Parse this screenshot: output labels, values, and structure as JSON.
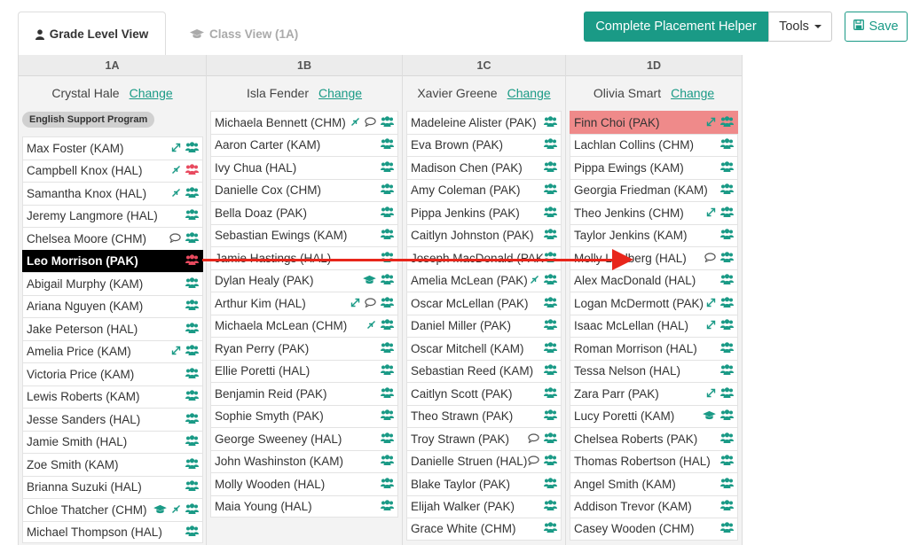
{
  "tabs": [
    {
      "label": "Grade Level View",
      "active": true,
      "icon": "user-icon"
    },
    {
      "label": "Class View (1A)",
      "active": false,
      "icon": "graduation-cap-icon"
    }
  ],
  "toolbar": {
    "helper_label": "Complete Placement Helper",
    "tools_label": "Tools",
    "save_label": "Save"
  },
  "colors": {
    "accent": "#1a9a86",
    "selected": "#000000",
    "flag_red": "#ef8a8a",
    "highlight": "#cccbf3",
    "arrow": "#e8261b"
  },
  "change_label": "Change",
  "classes": [
    {
      "name": "1A",
      "teacher": "Crystal Hale",
      "program": "English Support Program",
      "students": [
        {
          "name": "Max Foster (KAM)",
          "icons": [
            "arrows-icon",
            "group-icon"
          ]
        },
        {
          "name": "Campbell Knox (HAL)",
          "icons": [
            "arrows-in-icon",
            "group-red-icon"
          ]
        },
        {
          "name": "Samantha Knox (HAL)",
          "icons": [
            "arrows-in-icon",
            "group-icon"
          ]
        },
        {
          "name": "Jeremy Langmore (HAL)",
          "icons": [
            "group-icon"
          ]
        },
        {
          "name": "Chelsea Moore (CHM)",
          "icons": [
            "comment-icon",
            "group-icon"
          ]
        },
        {
          "name": "Leo Morrison (PAK)",
          "icons": [
            "group-red-icon"
          ],
          "state": "selected"
        },
        {
          "name": "Abigail Murphy (KAM)",
          "icons": [
            "group-icon"
          ]
        },
        {
          "name": "Ariana Nguyen (KAM)",
          "icons": [
            "group-icon"
          ]
        },
        {
          "name": "Jake Peterson (HAL)",
          "icons": [
            "group-icon"
          ]
        },
        {
          "name": "Amelia Price (KAM)",
          "icons": [
            "arrows-icon",
            "group-icon"
          ]
        },
        {
          "name": "Victoria Price (KAM)",
          "icons": [
            "group-icon"
          ]
        },
        {
          "name": "Lewis Roberts (KAM)",
          "icons": [
            "group-icon"
          ]
        },
        {
          "name": "Jesse Sanders (HAL)",
          "icons": [
            "group-icon"
          ]
        },
        {
          "name": "Jamie Smith (HAL)",
          "icons": [
            "group-icon"
          ]
        },
        {
          "name": "Zoe Smith (KAM)",
          "icons": [
            "group-icon"
          ]
        },
        {
          "name": "Brianna Suzuki (HAL)",
          "icons": [
            "group-icon"
          ]
        },
        {
          "name": "Chloe Thatcher (CHM)",
          "icons": [
            "graduation-cap-icon",
            "arrows-in-icon",
            "group-icon"
          ]
        },
        {
          "name": "Michael Thompson (HAL)",
          "icons": [
            "group-icon"
          ]
        }
      ]
    },
    {
      "name": "1B",
      "teacher": "Isla Fender",
      "students": [
        {
          "name": "Michaela Bennett (CHM)",
          "icons": [
            "arrows-in-icon",
            "comment-icon",
            "group-icon"
          ]
        },
        {
          "name": "Aaron Carter (KAM)",
          "icons": [
            "group-icon"
          ]
        },
        {
          "name": "Ivy Chua (HAL)",
          "icons": [
            "group-icon"
          ]
        },
        {
          "name": "Danielle Cox (CHM)",
          "icons": [
            "group-icon"
          ]
        },
        {
          "name": "Bella Doaz (PAK)",
          "icons": [
            "group-icon"
          ]
        },
        {
          "name": "Sebastian Ewings (KAM)",
          "icons": [
            "group-icon"
          ]
        },
        {
          "name": "Jamie Hastings (HAL)",
          "icons": [
            "group-icon"
          ]
        },
        {
          "name": "Dylan Healy (PAK)",
          "icons": [
            "graduation-cap-icon",
            "group-icon"
          ]
        },
        {
          "name": "Arthur Kim (HAL)",
          "icons": [
            "arrows-icon",
            "comment-icon",
            "group-icon"
          ]
        },
        {
          "name": "Michaela McLean (CHM)",
          "icons": [
            "arrows-in-icon",
            "group-icon"
          ]
        },
        {
          "name": "Ryan Perry (PAK)",
          "icons": [
            "group-icon"
          ]
        },
        {
          "name": "Ellie Poretti (HAL)",
          "icons": [
            "group-icon"
          ]
        },
        {
          "name": "Benjamin Reid (PAK)",
          "icons": [
            "group-icon"
          ]
        },
        {
          "name": "Sophie Smyth (PAK)",
          "icons": [
            "group-icon"
          ]
        },
        {
          "name": "George Sweeney (HAL)",
          "icons": [
            "group-icon"
          ]
        },
        {
          "name": "John Washinston (KAM)",
          "icons": [
            "group-icon"
          ]
        },
        {
          "name": "Molly Wooden (HAL)",
          "icons": [
            "group-icon"
          ]
        },
        {
          "name": "Maia Young (HAL)",
          "icons": [
            "group-icon"
          ]
        }
      ]
    },
    {
      "name": "1C",
      "teacher": "Xavier Greene",
      "students": [
        {
          "name": "Madeleine Alister (PAK)",
          "icons": [
            "group-icon"
          ]
        },
        {
          "name": "Eva Brown (PAK)",
          "icons": [
            "group-icon"
          ]
        },
        {
          "name": "Madison Chen (PAK)",
          "icons": [
            "group-icon"
          ]
        },
        {
          "name": "Amy Coleman (PAK)",
          "icons": [
            "group-icon"
          ]
        },
        {
          "name": "Pippa Jenkins (PAK)",
          "icons": [
            "group-icon"
          ]
        },
        {
          "name": "Caitlyn Johnston (PAK)",
          "icons": [
            "group-icon"
          ]
        },
        {
          "name": "Joseph MacDonald (PAK)",
          "icons": [
            "group-icon"
          ]
        },
        {
          "name": "Amelia McLean (PAK)",
          "icons": [
            "arrows-in-icon",
            "group-icon"
          ]
        },
        {
          "name": "Oscar McLellan (PAK)",
          "icons": [
            "group-icon"
          ]
        },
        {
          "name": "Daniel Miller (PAK)",
          "icons": [
            "group-icon"
          ]
        },
        {
          "name": "Oscar Mitchell (KAM)",
          "icons": [
            "group-icon"
          ]
        },
        {
          "name": "Sebastian Reed (KAM)",
          "icons": [
            "group-icon"
          ]
        },
        {
          "name": "Caitlyn Scott (PAK)",
          "icons": [
            "group-icon"
          ]
        },
        {
          "name": "Theo Strawn (PAK)",
          "icons": [
            "group-icon"
          ],
          "state": "highlight"
        },
        {
          "name": "Troy Strawn (PAK)",
          "icons": [
            "comment-icon",
            "group-icon"
          ]
        },
        {
          "name": "Danielle Struen (HAL)",
          "icons": [
            "comment-icon",
            "group-icon"
          ]
        },
        {
          "name": "Blake Taylor (PAK)",
          "icons": [
            "group-icon"
          ]
        },
        {
          "name": "Elijah Walker (PAK)",
          "icons": [
            "group-icon"
          ],
          "state": "highlight"
        },
        {
          "name": "Grace White (CHM)",
          "icons": [
            "group-icon"
          ]
        }
      ]
    },
    {
      "name": "1D",
      "teacher": "Olivia Smart",
      "students": [
        {
          "name": "Finn Choi (PAK)",
          "icons": [
            "arrows-icon",
            "group-icon"
          ],
          "state": "red"
        },
        {
          "name": "Lachlan Collins (CHM)",
          "icons": [
            "group-icon"
          ]
        },
        {
          "name": "Pippa Ewings (KAM)",
          "icons": [
            "group-icon"
          ]
        },
        {
          "name": "Georgia Friedman (KAM)",
          "icons": [
            "group-icon"
          ]
        },
        {
          "name": "Theo Jenkins (CHM)",
          "icons": [
            "arrows-icon",
            "group-icon"
          ]
        },
        {
          "name": "Taylor Jenkins (KAM)",
          "icons": [
            "group-icon"
          ]
        },
        {
          "name": "Molly Lindberg (HAL)",
          "icons": [
            "comment-icon",
            "group-icon"
          ]
        },
        {
          "name": "Alex MacDonald (HAL)",
          "icons": [
            "group-icon"
          ],
          "state": "highlight"
        },
        {
          "name": "Logan McDermott (PAK)",
          "icons": [
            "arrows-icon",
            "group-icon"
          ]
        },
        {
          "name": "Isaac McLellan (HAL)",
          "icons": [
            "arrows-icon",
            "group-icon"
          ]
        },
        {
          "name": "Roman Morrison (HAL)",
          "icons": [
            "group-icon"
          ]
        },
        {
          "name": "Tessa Nelson (HAL)",
          "icons": [
            "group-icon"
          ]
        },
        {
          "name": "Zara Parr (PAK)",
          "icons": [
            "arrows-icon",
            "group-icon"
          ]
        },
        {
          "name": "Lucy Poretti (KAM)",
          "icons": [
            "graduation-cap-icon",
            "group-icon"
          ]
        },
        {
          "name": "Chelsea Roberts (PAK)",
          "icons": [
            "group-icon"
          ]
        },
        {
          "name": "Thomas Robertson (HAL)",
          "icons": [
            "group-icon"
          ]
        },
        {
          "name": "Angel Smith (KAM)",
          "icons": [
            "group-icon"
          ]
        },
        {
          "name": "Addison Trevor (KAM)",
          "icons": [
            "group-icon"
          ]
        },
        {
          "name": "Casey Wooden (CHM)",
          "icons": [
            "group-icon"
          ],
          "state": "highlight"
        }
      ]
    }
  ]
}
